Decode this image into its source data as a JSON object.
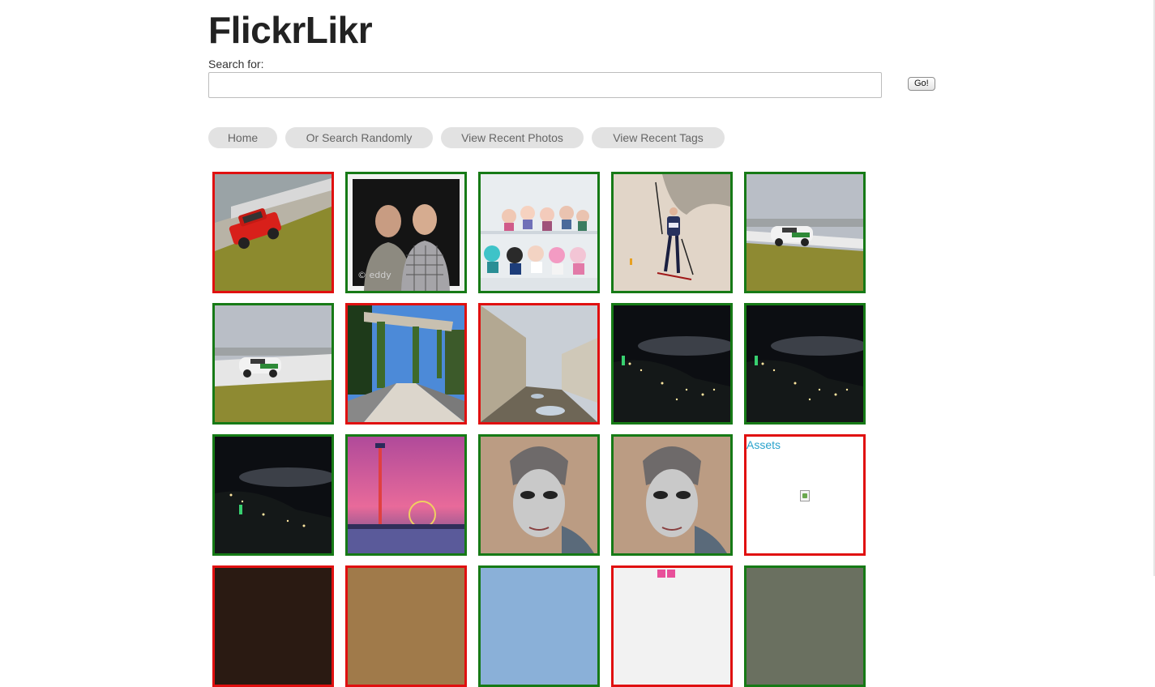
{
  "app": {
    "title": "FlickrLikr"
  },
  "search": {
    "label": "Search for:",
    "value": "",
    "placeholder": "",
    "go_label": "Go!"
  },
  "nav": {
    "items": [
      {
        "label": "Home"
      },
      {
        "label": "Or Search Randomly"
      },
      {
        "label": "View Recent Photos"
      },
      {
        "label": "View Recent Tags"
      }
    ]
  },
  "colors": {
    "liked_border": "#167a16",
    "disliked_border": "#e01010",
    "link": "#2aa3cc"
  },
  "photos": [
    {
      "status": "disliked",
      "subject": "red rally car on racetrack",
      "icon": "photo-icon"
    },
    {
      "status": "liked",
      "subject": "two men portrait",
      "watermark": "© eddy"
    },
    {
      "status": "liked",
      "subject": "anime figurines in display case"
    },
    {
      "status": "liked",
      "subject": "skier on snowy slope"
    },
    {
      "status": "liked",
      "subject": "white race car on track"
    },
    {
      "status": "liked",
      "subject": "white race car on track"
    },
    {
      "status": "disliked",
      "subject": "garden pergola walkway"
    },
    {
      "status": "disliked",
      "subject": "muddy lane beside wall"
    },
    {
      "status": "liked",
      "subject": "city lights at night"
    },
    {
      "status": "liked",
      "subject": "city lights at night"
    },
    {
      "status": "liked",
      "subject": "city lights at night"
    },
    {
      "status": "liked",
      "subject": "pier with ferris wheel at sunset"
    },
    {
      "status": "liked",
      "subject": "venetian carnival mask"
    },
    {
      "status": "liked",
      "subject": "venetian carnival mask"
    },
    {
      "status": "disliked",
      "subject": "broken image",
      "caption": "Assets"
    },
    {
      "status": "disliked",
      "subject": "partially visible photo"
    },
    {
      "status": "disliked",
      "subject": "partially visible photo"
    },
    {
      "status": "liked",
      "subject": "partially visible photo"
    },
    {
      "status": "disliked",
      "subject": "partially visible photo"
    },
    {
      "status": "liked",
      "subject": "partially visible photo"
    }
  ]
}
